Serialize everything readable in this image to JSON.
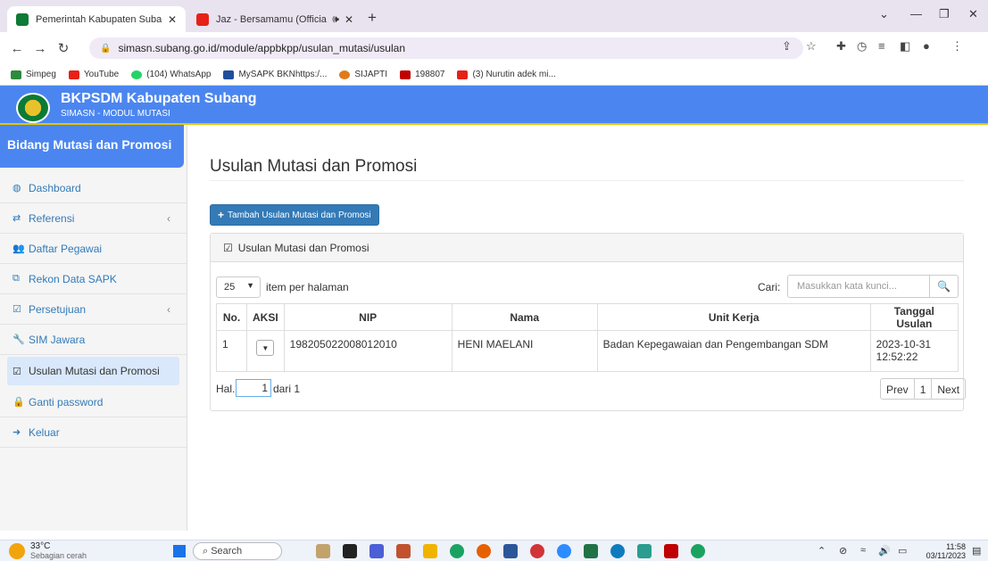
{
  "browser": {
    "tabs": [
      {
        "title": "Pemerintah Kabupaten Subang",
        "active": true,
        "favicon_color": "#0d7a35"
      },
      {
        "title": "Jaz - Bersamamu (Official Ly",
        "active": false,
        "favicon_color": "#e62117"
      }
    ],
    "address": "simasn.subang.go.id/module/appbkpp/usulan_mutasi/usulan",
    "bookmarks": [
      {
        "label": "Simpeg",
        "color": "#2d8a3e"
      },
      {
        "label": "YouTube",
        "color": "#e62117"
      },
      {
        "label": "(104) WhatsApp",
        "color": "#25d366"
      },
      {
        "label": "MySAPK BKNhttps:/...",
        "color": "#1f4e9c"
      },
      {
        "label": "SIJAPTI",
        "color": "#e07b1a"
      },
      {
        "label": "198807",
        "color": "#c00000"
      },
      {
        "label": "(3) Nurutin adek mi...",
        "color": "#e62117"
      }
    ]
  },
  "header": {
    "title": "BKPSDM Kabupaten Subang",
    "subtitle": "SIMASN - MODUL MUTASI"
  },
  "sidebar": {
    "heading": "Bidang Mutasi dan Promosi",
    "items": [
      {
        "label": "Dashboard",
        "icon": "dashboard-icon"
      },
      {
        "label": "Referensi",
        "icon": "exchange-icon"
      },
      {
        "label": "Daftar Pegawai",
        "icon": "users-icon"
      },
      {
        "label": "Rekon Data SAPK",
        "icon": "sitemap-icon"
      },
      {
        "label": "Persetujuan",
        "icon": "check-square-icon"
      },
      {
        "label": "SIM Jawara",
        "icon": "wrench-icon"
      },
      {
        "label": "Usulan Mutasi dan Promosi",
        "icon": "check-square-icon"
      },
      {
        "label": "Ganti password",
        "icon": "lock-icon"
      },
      {
        "label": "Keluar",
        "icon": "sign-out-icon"
      }
    ]
  },
  "main": {
    "title": "Usulan Mutasi dan Promosi",
    "add_button": "Tambah Usulan Mutasi dan Promosi",
    "panel_title": "Usulan Mutasi dan Promosi",
    "per_page_value": "25",
    "per_page_label": "item per halaman",
    "search_label": "Cari:",
    "search_placeholder": "Masukkan kata kunci...",
    "columns": [
      "No.",
      "AKSI",
      "NIP",
      "Nama",
      "Unit Kerja",
      "Tanggal Usulan"
    ],
    "rows": [
      {
        "no": "1",
        "nip": "198205022008012010",
        "nama": "HENI MAELANI",
        "unit": "Badan Kepegawaian dan Pengembangan SDM",
        "date": "2023-10-31",
        "time": "12:52:22"
      }
    ],
    "page_label": "Hal.",
    "page_value": "1",
    "page_total": "dari 1",
    "pager": {
      "prev": "Prev",
      "current": "1",
      "next": "Next"
    }
  },
  "taskbar": {
    "temperature": "33°C",
    "weather": "Sebagian cerah",
    "search": "Search",
    "time": "11:58",
    "date": "03/11/2023"
  }
}
